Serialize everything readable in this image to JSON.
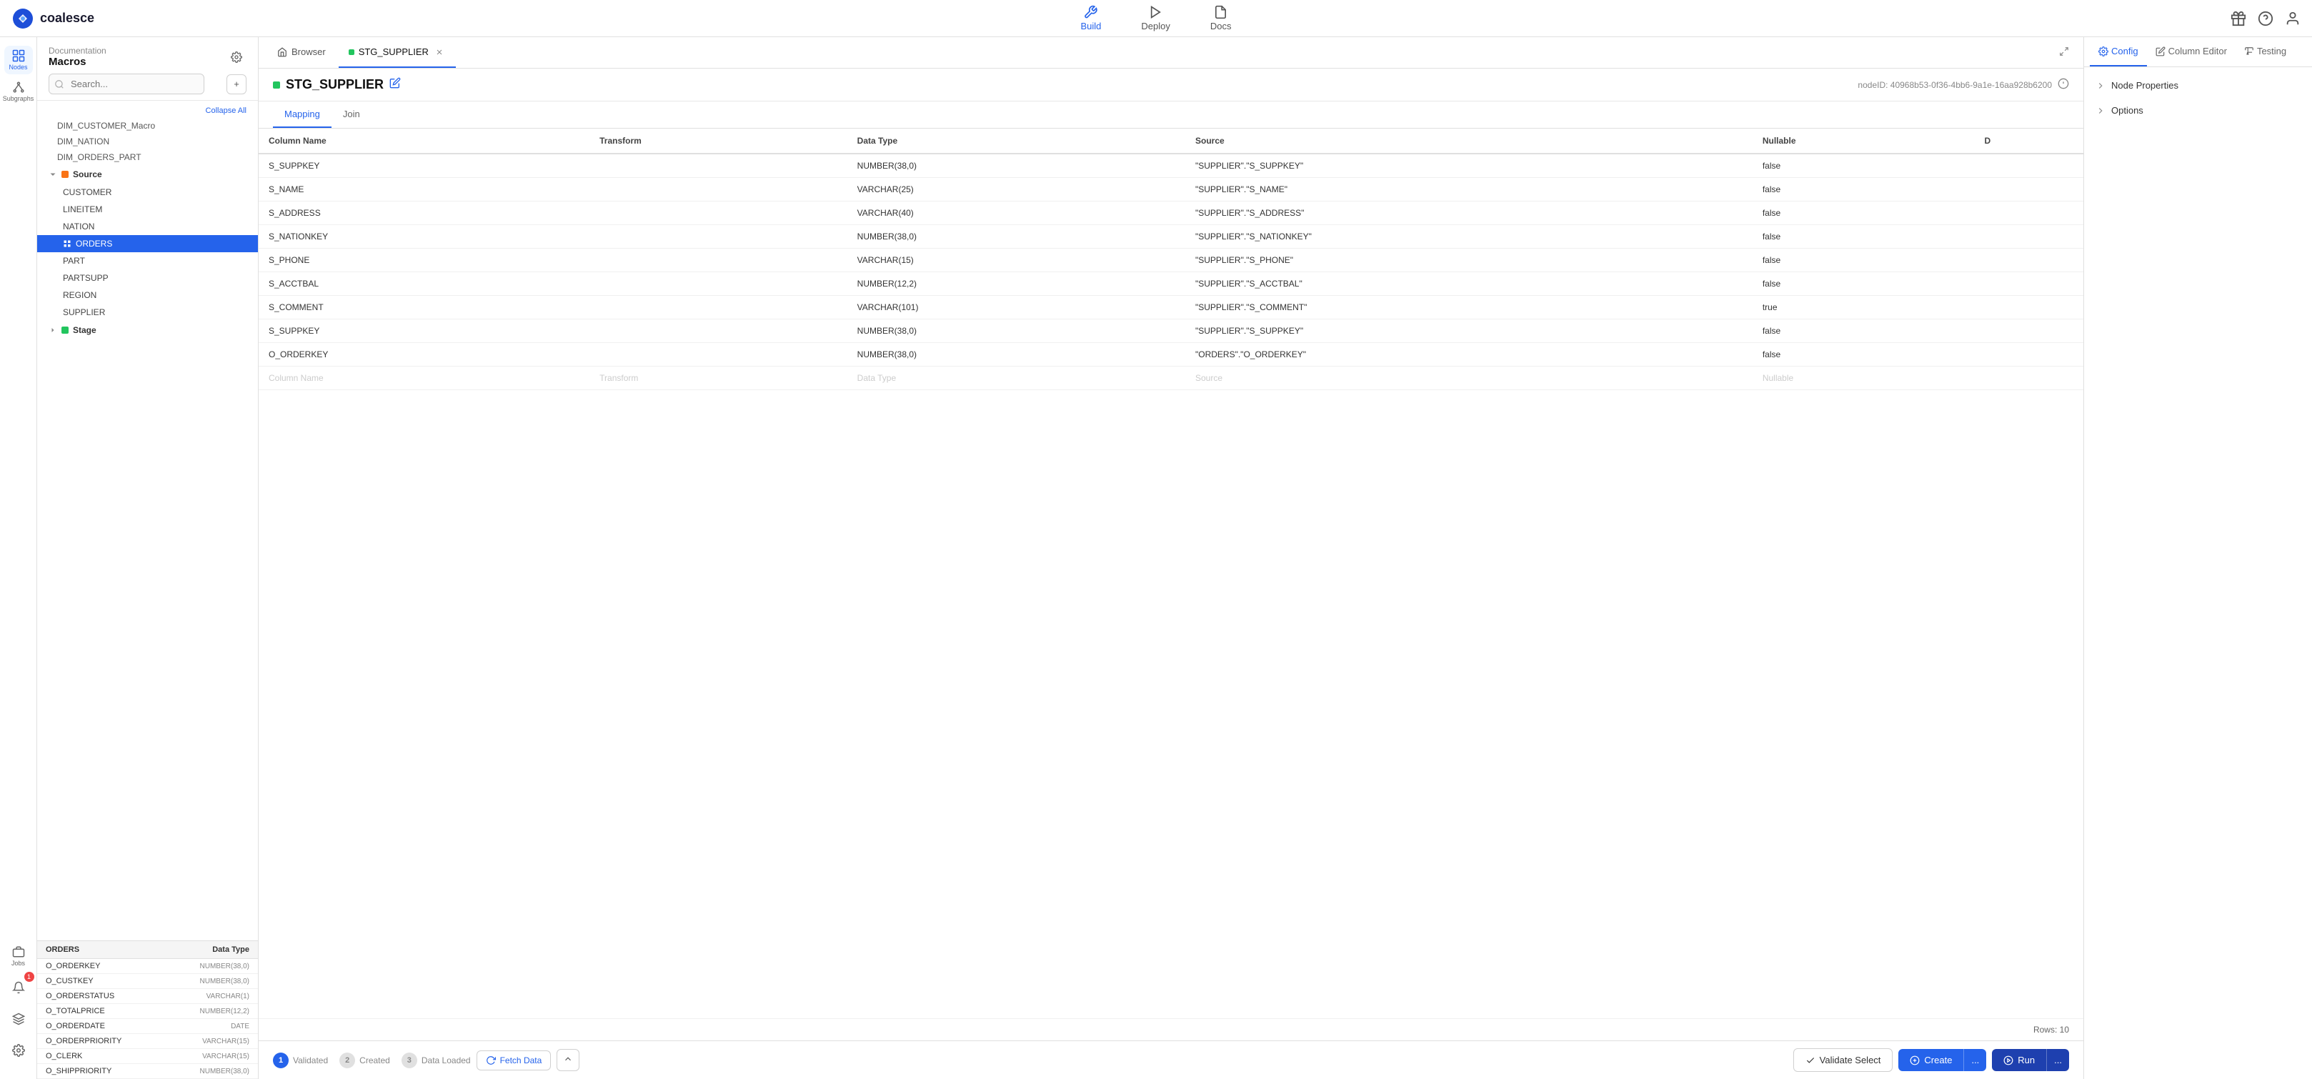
{
  "app": {
    "logo_text": "coalesce",
    "logo_icon": "⬡"
  },
  "top_nav": {
    "items": [
      {
        "id": "build",
        "label": "Build",
        "active": true
      },
      {
        "id": "deploy",
        "label": "Deploy",
        "active": false
      },
      {
        "id": "docs",
        "label": "Docs",
        "active": false
      }
    ],
    "right_icons": [
      "gift-icon",
      "help-icon",
      "user-icon"
    ]
  },
  "left_icon_sidebar": {
    "top_items": [
      {
        "id": "nodes",
        "label": "Nodes",
        "active": true
      },
      {
        "id": "subgraphs",
        "label": "Subgraphs",
        "active": false
      }
    ],
    "bottom_items": [
      {
        "id": "jobs",
        "label": "Jobs",
        "active": false
      },
      {
        "id": "builds",
        "label": "",
        "active": false
      },
      {
        "id": "settings",
        "label": "",
        "active": false
      }
    ]
  },
  "left_panel": {
    "workspace_label": "Documentation",
    "workspace_name": "Macros",
    "search_placeholder": "Search...",
    "add_button_label": "+",
    "collapse_all_label": "Collapse All",
    "macros": [
      {
        "id": "dim_customer",
        "label": "DIM_CUSTOMER_Macro"
      },
      {
        "id": "dim_nation",
        "label": "DIM_NATION"
      },
      {
        "id": "dim_orders_part",
        "label": "DIM_ORDERS_PART"
      }
    ],
    "sections": [
      {
        "id": "source",
        "label": "Source",
        "color": "orange",
        "expanded": true,
        "nodes": [
          {
            "id": "customer",
            "label": "CUSTOMER",
            "active": false
          },
          {
            "id": "lineitem",
            "label": "LINEITEM",
            "active": false
          },
          {
            "id": "nation",
            "label": "NATION",
            "active": false
          },
          {
            "id": "orders",
            "label": "ORDERS",
            "active": true
          },
          {
            "id": "part",
            "label": "PART",
            "active": false
          },
          {
            "id": "partsupp",
            "label": "PARTSUPP",
            "active": false
          },
          {
            "id": "region",
            "label": "REGION",
            "active": false
          },
          {
            "id": "supplier",
            "label": "SUPPLIER",
            "active": false
          }
        ]
      },
      {
        "id": "stage",
        "label": "Stage",
        "color": "green",
        "expanded": false,
        "nodes": []
      }
    ]
  },
  "bottom_data_panel": {
    "col_name_header": "ORDERS",
    "col_type_header": "Data Type",
    "rows": [
      {
        "name": "O_ORDERKEY",
        "type": "NUMBER(38,0)"
      },
      {
        "name": "O_CUSTKEY",
        "type": "NUMBER(38,0)"
      },
      {
        "name": "O_ORDERSTATUS",
        "type": "VARCHAR(1)"
      },
      {
        "name": "O_TOTALPRICE",
        "type": "NUMBER(12,2)"
      },
      {
        "name": "O_ORDERDATE",
        "type": "DATE"
      },
      {
        "name": "O_ORDERPRIORITY",
        "type": "VARCHAR(15)"
      },
      {
        "name": "O_CLERK",
        "type": "VARCHAR(15)"
      },
      {
        "name": "O_SHIPPRIORITY",
        "type": "NUMBER(38,0)"
      }
    ]
  },
  "tabs": [
    {
      "id": "browser",
      "label": "Browser",
      "active": false
    },
    {
      "id": "stg_supplier",
      "label": "STG_SUPPLIER",
      "active": true,
      "color": "green"
    }
  ],
  "node_header": {
    "title": "STG_SUPPLIER",
    "node_id": "nodeID: 40968b53-0f36-4bb6-9a1e-16aa928b6200"
  },
  "sub_tabs": [
    {
      "id": "mapping",
      "label": "Mapping",
      "active": true
    },
    {
      "id": "join",
      "label": "Join",
      "active": false
    }
  ],
  "table": {
    "headers": [
      "Column Name",
      "Transform",
      "Data Type",
      "Source",
      "Nullable",
      "D"
    ],
    "rows": [
      {
        "col_name": "S_SUPPKEY",
        "transform": "",
        "data_type": "NUMBER(38,0)",
        "source": "\"SUPPLIER\".\"S_SUPPKEY\"",
        "nullable": "false"
      },
      {
        "col_name": "S_NAME",
        "transform": "",
        "data_type": "VARCHAR(25)",
        "source": "\"SUPPLIER\".\"S_NAME\"",
        "nullable": "false"
      },
      {
        "col_name": "S_ADDRESS",
        "transform": "",
        "data_type": "VARCHAR(40)",
        "source": "\"SUPPLIER\".\"S_ADDRESS\"",
        "nullable": "false"
      },
      {
        "col_name": "S_NATIONKEY",
        "transform": "",
        "data_type": "NUMBER(38,0)",
        "source": "\"SUPPLIER\".\"S_NATIONKEY\"",
        "nullable": "false"
      },
      {
        "col_name": "S_PHONE",
        "transform": "",
        "data_type": "VARCHAR(15)",
        "source": "\"SUPPLIER\".\"S_PHONE\"",
        "nullable": "false"
      },
      {
        "col_name": "S_ACCTBAL",
        "transform": "",
        "data_type": "NUMBER(12,2)",
        "source": "\"SUPPLIER\".\"S_ACCTBAL\"",
        "nullable": "false"
      },
      {
        "col_name": "S_COMMENT",
        "transform": "",
        "data_type": "VARCHAR(101)",
        "source": "\"SUPPLIER\".\"S_COMMENT\"",
        "nullable": "true"
      },
      {
        "col_name": "S_SUPPKEY",
        "transform": "",
        "data_type": "NUMBER(38,0)",
        "source": "\"SUPPLIER\".\"S_SUPPKEY\"",
        "nullable": "false"
      },
      {
        "col_name": "O_ORDERKEY",
        "transform": "",
        "data_type": "NUMBER(38,0)",
        "source": "\"ORDERS\".\"O_ORDERKEY\"",
        "nullable": "false"
      }
    ],
    "empty_row": {
      "col_name": "Column Name",
      "transform": "Transform",
      "data_type": "Data Type",
      "source": "Source",
      "nullable": "Nullable"
    },
    "rows_count": "Rows: 10"
  },
  "bottom_bar": {
    "validate_label": "Validate Select",
    "create_label": "Create",
    "run_label": "Run",
    "more_label": "...",
    "steps": [
      {
        "id": "validated",
        "number": "1",
        "label": "Validated",
        "active": true
      },
      {
        "id": "created",
        "number": "2",
        "label": "Created",
        "active": false
      },
      {
        "id": "data_loaded",
        "number": "3",
        "label": "Data Loaded",
        "active": false
      }
    ],
    "fetch_data_label": "Fetch Data"
  },
  "right_panel": {
    "tabs": [
      {
        "id": "config",
        "label": "Config",
        "active": true
      },
      {
        "id": "column_editor",
        "label": "Column Editor",
        "active": false
      },
      {
        "id": "testing",
        "label": "Testing",
        "active": false
      }
    ],
    "sections": [
      {
        "id": "node_properties",
        "label": "Node Properties"
      },
      {
        "id": "options",
        "label": "Options"
      }
    ]
  }
}
